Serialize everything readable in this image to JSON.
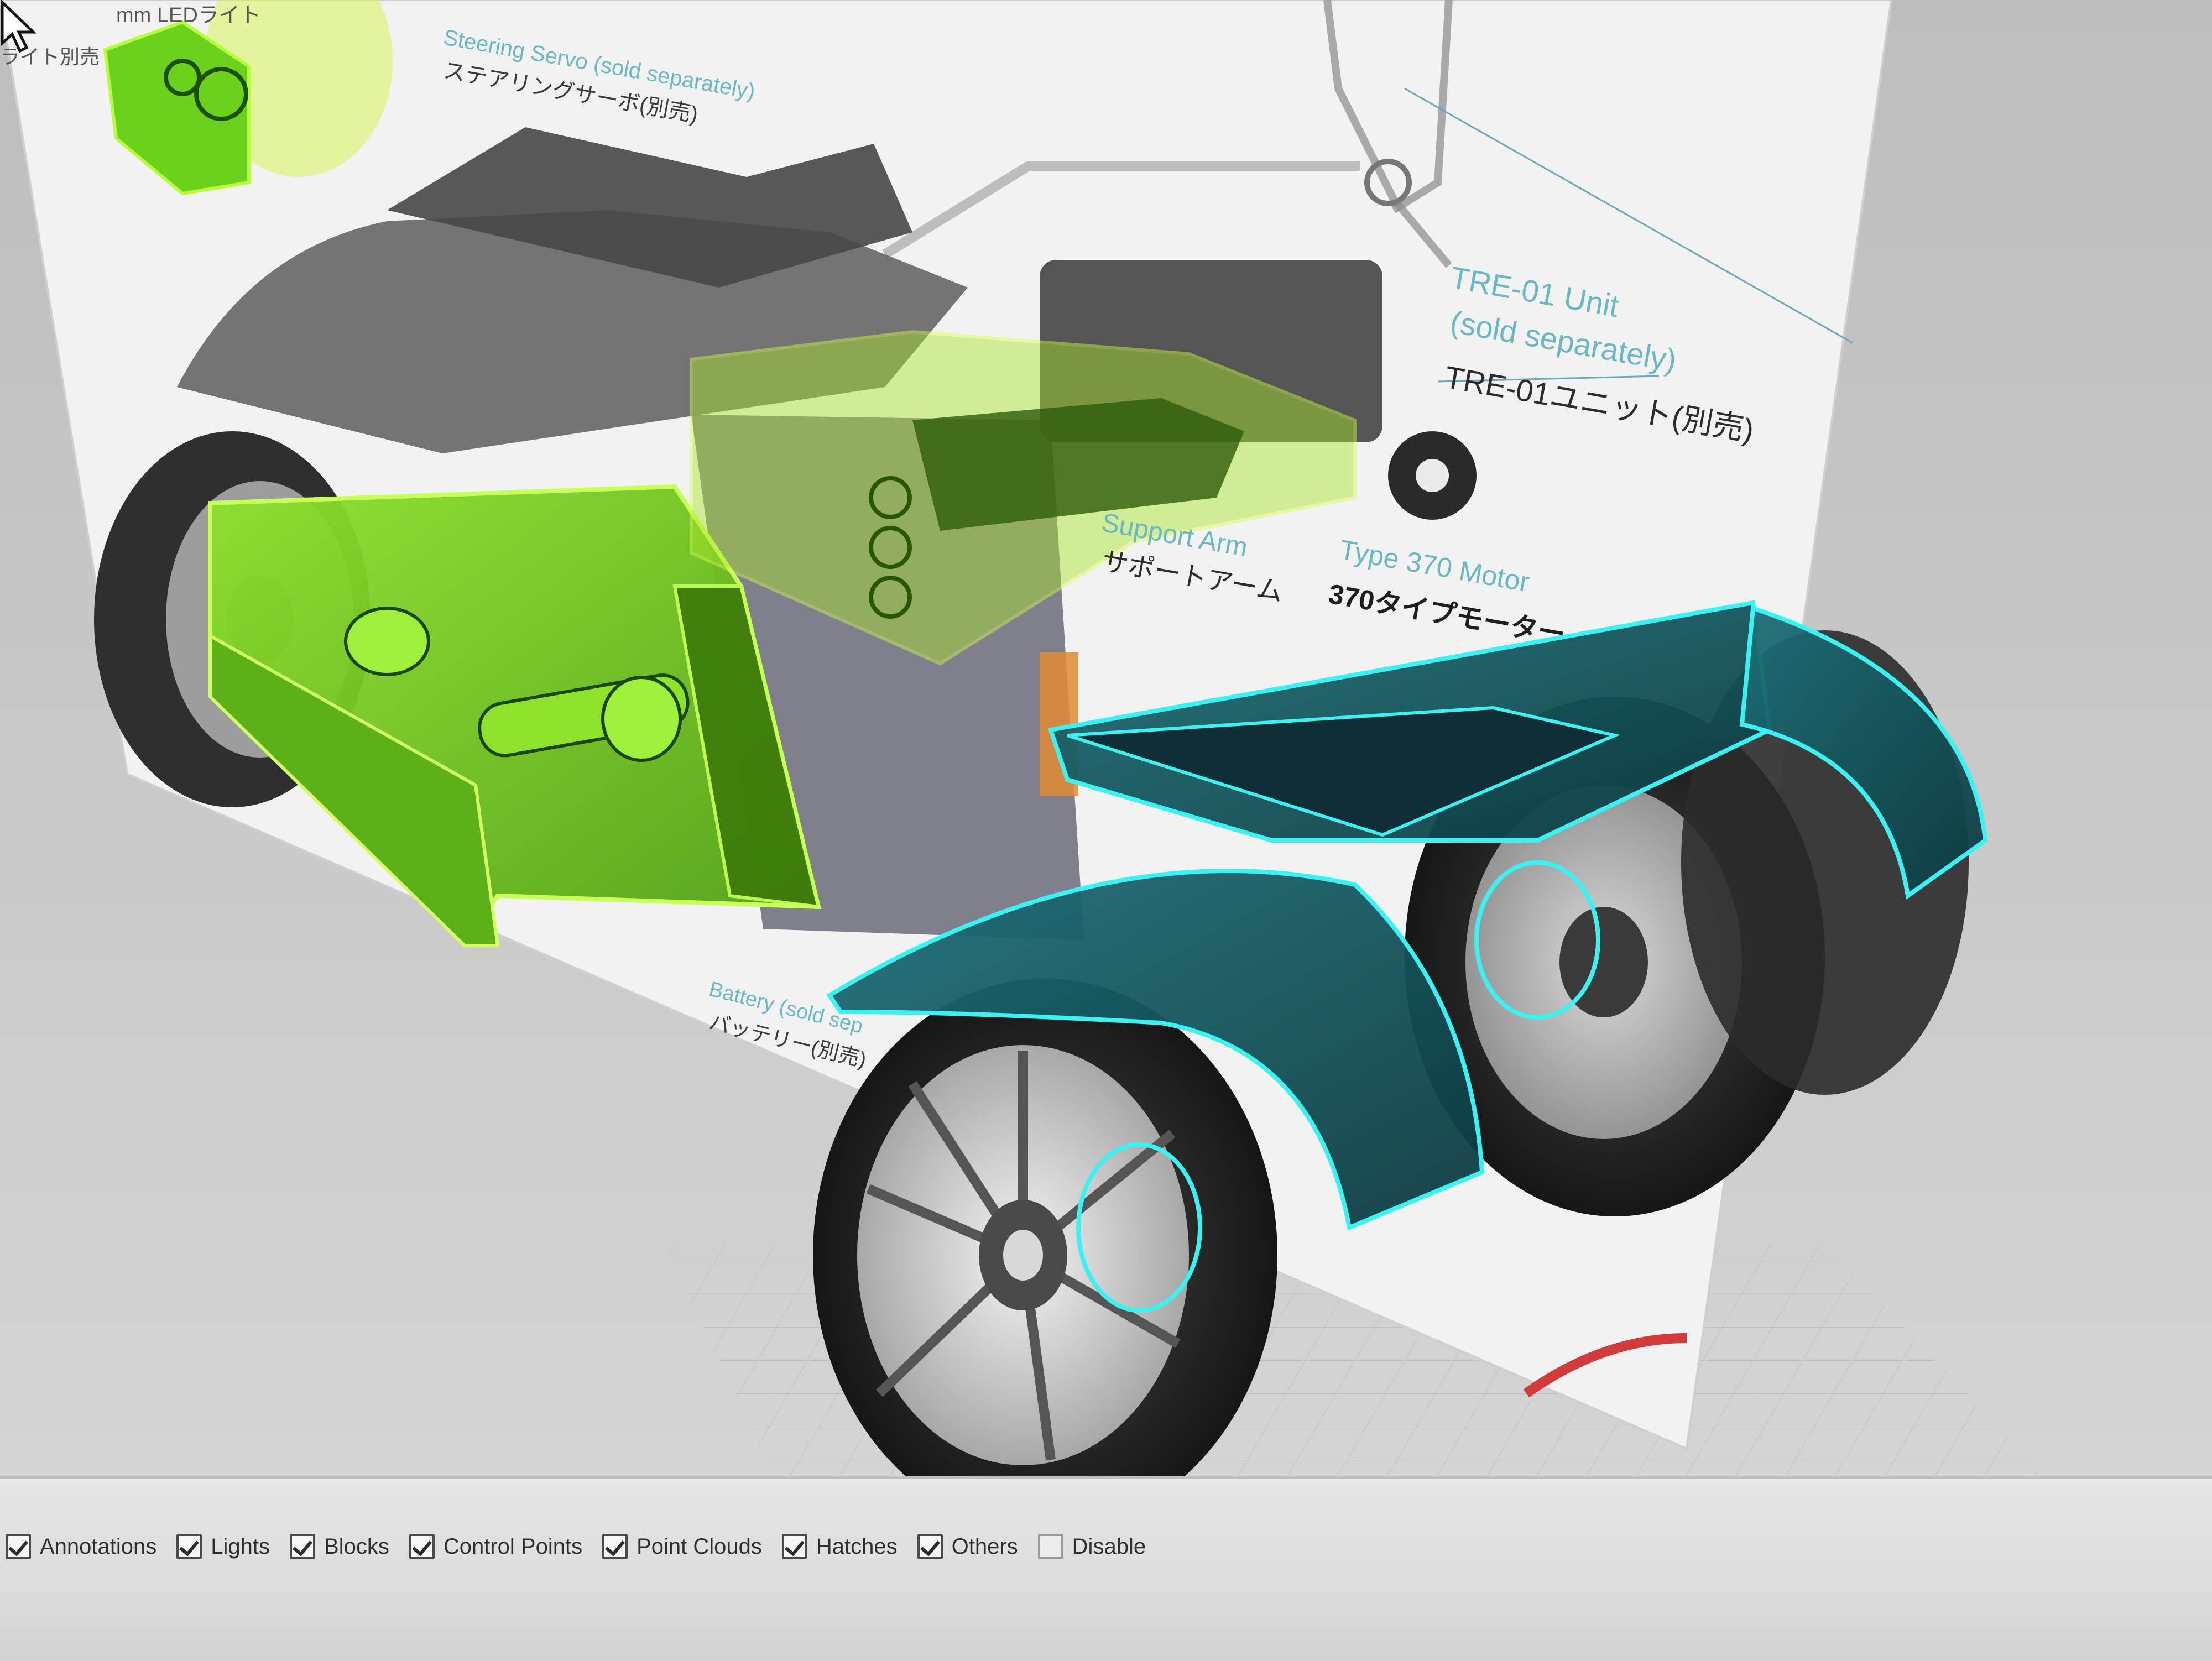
{
  "reference_image": {
    "labels": {
      "led_top": "mm LEDライト",
      "led_sub": "ライト別売",
      "steering_servo_en": "Steering Servo (sold separately)",
      "steering_servo_ja": "ステアリングサーボ(別売)",
      "tre01_en_line1": "TRE-01 Unit",
      "tre01_en_line2": "(sold separately)",
      "tre01_ja": "TRE-01ユニット(別売)",
      "support_arm_en": "Support Arm",
      "support_arm_ja": "サポートアーム",
      "motor_en": "Type 370 Motor",
      "motor_ja": "370タイプモーター",
      "battery_en": "Battery (sold sep",
      "battery_ja": "バッテリー(別売)"
    }
  },
  "colors": {
    "selection_green": "#7fdc1f",
    "selection_yellow_green": "#c8f03a",
    "selection_cyan": "#2fe3e6",
    "annotation_teal": "#69b8c4"
  },
  "filter_bar": {
    "items": [
      {
        "label": "Annotations",
        "checked": true
      },
      {
        "label": "Lights",
        "checked": true
      },
      {
        "label": "Blocks",
        "checked": true
      },
      {
        "label": "Control Points",
        "checked": true
      },
      {
        "label": "Point Clouds",
        "checked": true
      },
      {
        "label": "Hatches",
        "checked": true
      },
      {
        "label": "Others",
        "checked": true
      },
      {
        "label": "Disable",
        "checked": false
      }
    ]
  }
}
